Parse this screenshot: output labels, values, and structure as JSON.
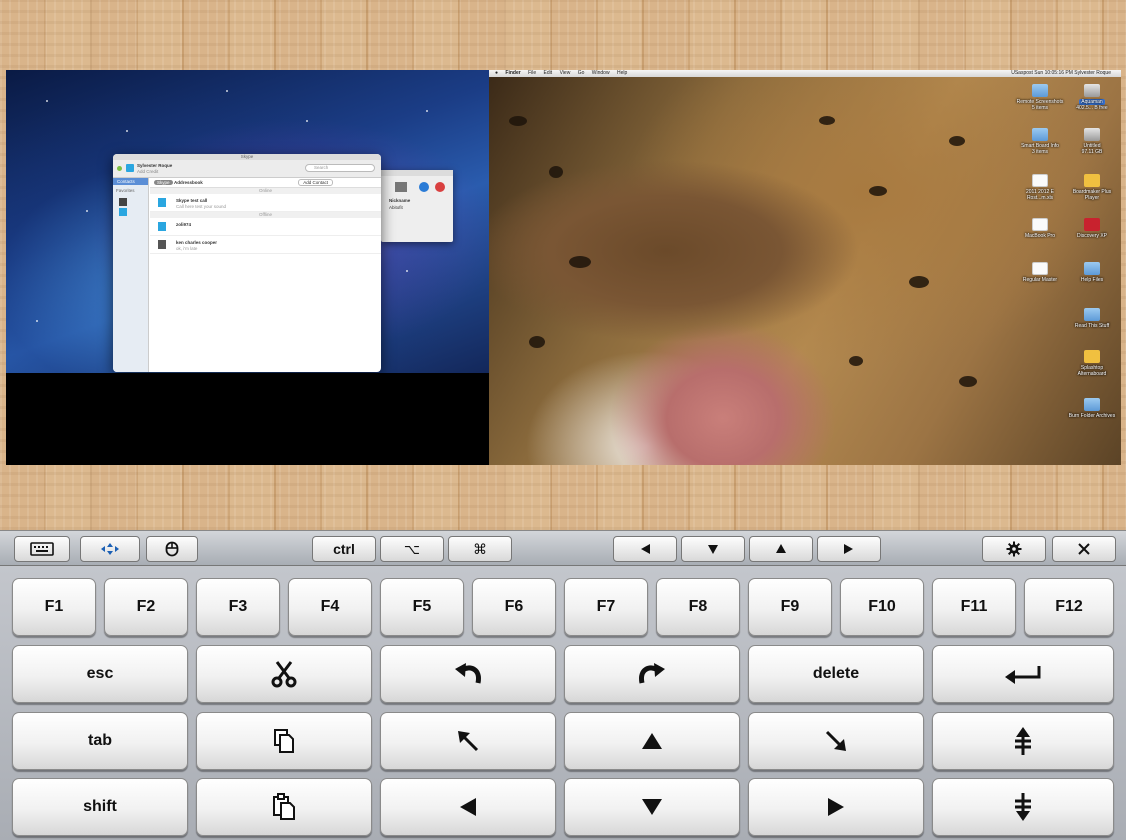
{
  "skype": {
    "window_title": "Skype",
    "user_name": "Sylvester Roque",
    "mood": "Add Credit",
    "search_placeholder": "Search",
    "contacts_tab": "Contacts",
    "favorites_label": "Favorites",
    "toolbar_pill": "Skype",
    "addressbook_label": "Addressbook",
    "add_contact": "Add Contact",
    "section_online": "Online",
    "section_offline": "Offline",
    "contacts": [
      {
        "name": "Skype test call",
        "sub": "Call here test your sound"
      },
      {
        "name": "zoli974",
        "sub": ""
      },
      {
        "name": "ken charles cooper",
        "sub": "ok, i'm late"
      }
    ],
    "side_panel_header": "Nickname",
    "side_panel_item": "Abitofit"
  },
  "mac": {
    "menu": [
      "Finder",
      "File",
      "Edit",
      "View",
      "Go",
      "Window",
      "Help"
    ],
    "status": "USaspost  Sun 10:05:16 PM  Sylvester Roque",
    "desktop_icons": [
      {
        "label": "Remote Screenshots",
        "sub": "5 items",
        "kind": "folder"
      },
      {
        "label": "Aquaman",
        "sub": "402.5... B free",
        "kind": "drive",
        "selected": true
      },
      {
        "label": "Smart Board Info",
        "sub": "3 items",
        "kind": "folder"
      },
      {
        "label": "Untitled",
        "sub": "97.11 GB",
        "kind": "drive"
      },
      {
        "label": "2011 2012 E Rost...m.xls",
        "sub": "",
        "kind": "doc"
      },
      {
        "label": "Boardmaker Plus Player",
        "sub": "",
        "kind": "yellow"
      },
      {
        "label": "MacBook Pro",
        "sub": "",
        "kind": "doc"
      },
      {
        "label": "Discovery XP",
        "sub": "",
        "kind": "red"
      },
      {
        "label": "Regular Master",
        "sub": "",
        "kind": "doc"
      },
      {
        "label": "Help Files",
        "sub": "",
        "kind": "folder"
      },
      {
        "label": "Read This Stuff",
        "sub": "",
        "kind": "folder"
      },
      {
        "label": "Splashtop Alternaboard",
        "sub": "",
        "kind": "yellow"
      },
      {
        "label": "Burn Folder Archives",
        "sub": "",
        "kind": "folder"
      }
    ]
  },
  "toolbar": {
    "ctrl": "ctrl",
    "option": "⌥",
    "command": "⌘"
  },
  "keyboard": {
    "function_keys": [
      "F1",
      "F2",
      "F3",
      "F4",
      "F5",
      "F6",
      "F7",
      "F8",
      "F9",
      "F10",
      "F11",
      "F12"
    ],
    "esc": "esc",
    "delete": "delete",
    "tab": "tab",
    "shift": "shift"
  }
}
